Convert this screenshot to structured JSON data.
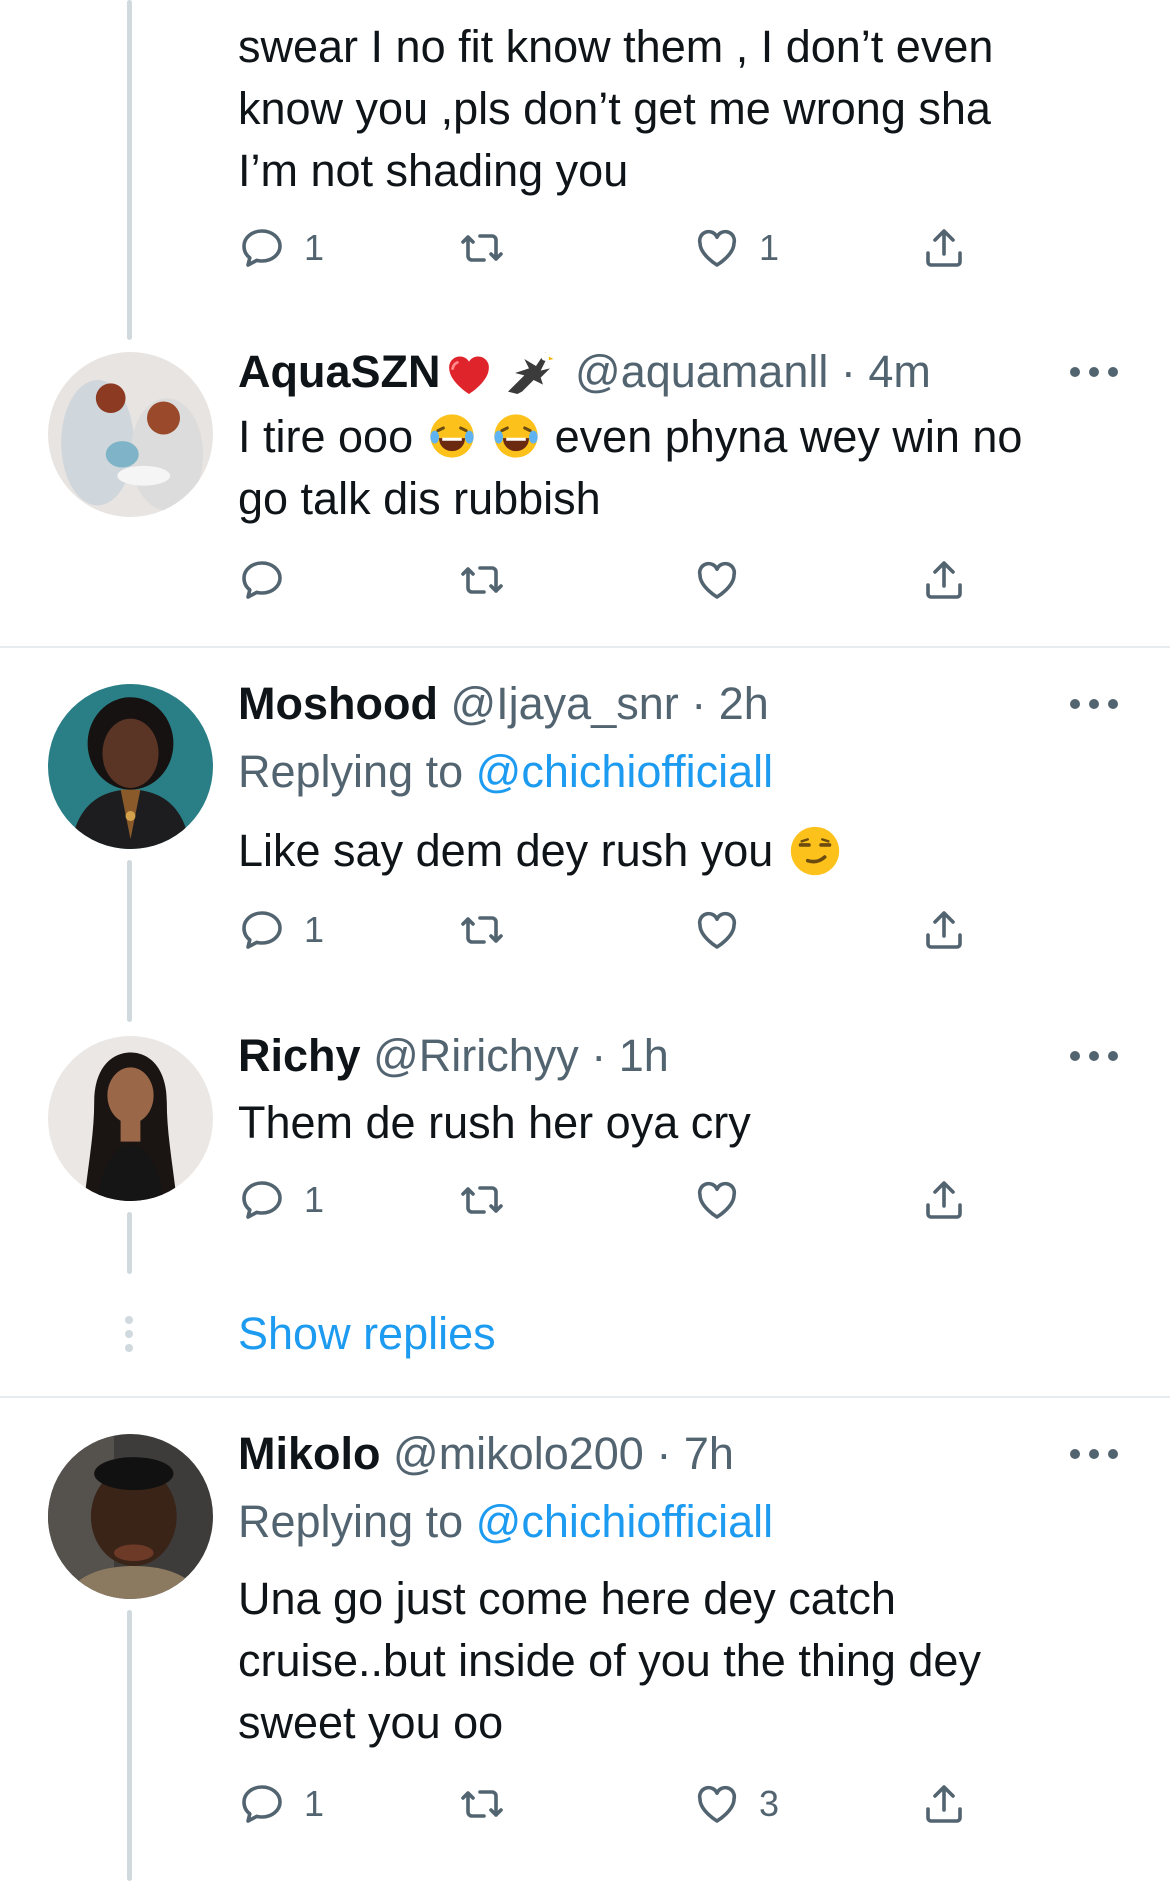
{
  "tweets": [
    {
      "text_lines": [
        "swear I no fit know them , I don’t even",
        "know you ,pls don’t get me wrong sha",
        "I’m not shading you"
      ],
      "reply_count": "1",
      "retweet_count": "",
      "like_count": "1"
    },
    {
      "name": "AquaSZN",
      "name_emojis": [
        "red-heart",
        "eagle"
      ],
      "handle": "@aquamanll",
      "time": "· 4m",
      "text_line1_a": "I tire ooo",
      "text_line1_emojis": [
        "tears-of-joy",
        "tears-of-joy"
      ],
      "text_line1_b": "even phyna wey win no",
      "text_line2": "go talk dis rubbish",
      "reply_count": "",
      "retweet_count": "",
      "like_count": ""
    },
    {
      "name": "Moshood",
      "handle": "@Ijaya_snr",
      "time": "· 2h",
      "replying_prefix": "Replying to",
      "replying_to": "@chichiofficiall",
      "text": "Like say dem dey rush you",
      "text_emoji": "smirking-face",
      "reply_count": "1",
      "retweet_count": "",
      "like_count": ""
    },
    {
      "name": "Richy",
      "handle": "@Ririchyy",
      "time": "· 1h",
      "text": "Them de rush her oya cry",
      "reply_count": "1",
      "retweet_count": "",
      "like_count": ""
    },
    {
      "name": "Mikolo",
      "handle": "@mikolo200",
      "time": "· 7h",
      "replying_prefix": "Replying to",
      "replying_to": "@chichiofficiall",
      "text_lines": [
        "Una go just come here dey catch",
        "cruise..but inside of you the thing dey",
        "sweet you oo"
      ],
      "reply_count": "1",
      "retweet_count": "",
      "like_count": "3"
    }
  ],
  "show_replies_label": "Show replies",
  "icons": {
    "reply": "reply-icon",
    "retweet": "retweet-icon",
    "like": "heart-icon",
    "share": "share-icon",
    "more": "more-icon"
  },
  "colors": {
    "link": "#1d9bf0",
    "secondary_text": "#536471",
    "primary_text": "#0f1419",
    "thread_line": "#cfd9de",
    "divider": "#e6ecf0"
  }
}
